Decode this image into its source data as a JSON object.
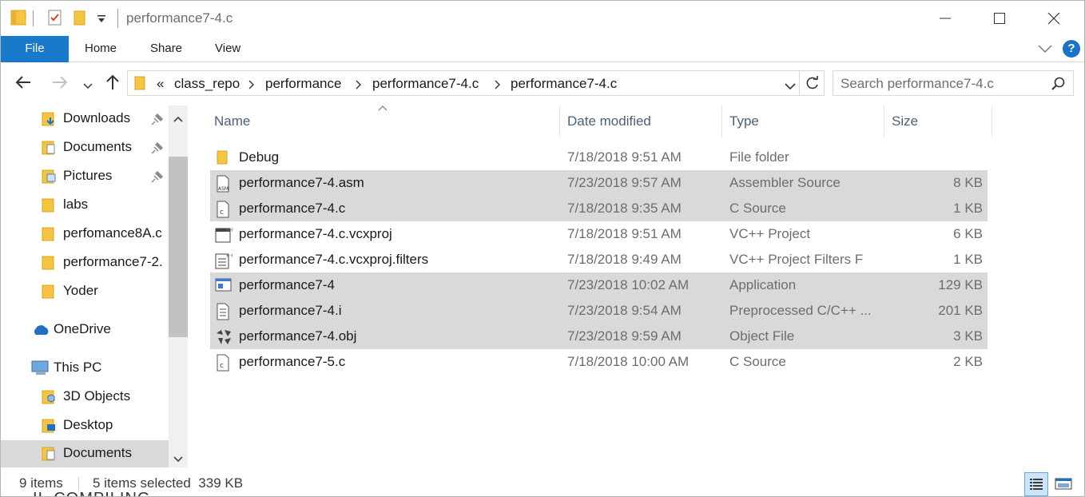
{
  "window": {
    "title": "performance7-4.c"
  },
  "ribbon": {
    "tabs": [
      "File",
      "Home",
      "Share",
      "View"
    ],
    "help_label": "?"
  },
  "address": {
    "overflow_glyph": "«",
    "crumbs": [
      "class_repo",
      "performance",
      "performance7-4.c",
      "performance7-4.c"
    ]
  },
  "search": {
    "placeholder": "Search performance7-4.c"
  },
  "navpane": {
    "items": [
      {
        "label": "Downloads",
        "icon": "downloads-folder-icon",
        "pinned": true,
        "selected": false
      },
      {
        "label": "Documents",
        "icon": "documents-folder-icon",
        "pinned": true,
        "selected": false
      },
      {
        "label": "Pictures",
        "icon": "pictures-folder-icon",
        "pinned": true,
        "selected": false
      },
      {
        "label": "labs",
        "icon": "folder-icon",
        "pinned": false,
        "selected": false
      },
      {
        "label": "perfomance8A.c",
        "icon": "folder-icon",
        "pinned": false,
        "selected": false
      },
      {
        "label": "performance7-2.",
        "icon": "folder-icon",
        "pinned": false,
        "selected": false
      },
      {
        "label": "Yoder",
        "icon": "folder-icon",
        "pinned": false,
        "selected": false
      },
      {
        "label": "OneDrive",
        "icon": "onedrive-cloud-icon",
        "pinned": false,
        "selected": false
      },
      {
        "label": "This PC",
        "icon": "this-pc-icon",
        "pinned": false,
        "selected": false
      },
      {
        "label": "3D Objects",
        "icon": "3d-objects-folder-icon",
        "pinned": false,
        "selected": false
      },
      {
        "label": "Desktop",
        "icon": "desktop-folder-icon",
        "pinned": false,
        "selected": false
      },
      {
        "label": "Documents",
        "icon": "documents-folder-icon",
        "pinned": false,
        "selected": true
      }
    ]
  },
  "columns": [
    "Name",
    "Date modified",
    "Type",
    "Size"
  ],
  "files": [
    {
      "name": "Debug",
      "date": "7/18/2018 9:51 AM",
      "type": "File folder",
      "size": "",
      "icon": "folder-icon",
      "selected": false
    },
    {
      "name": "performance7-4.asm",
      "date": "7/23/2018 9:57 AM",
      "type": "Assembler Source",
      "size": "8 KB",
      "icon": "asm-file-icon",
      "selected": true
    },
    {
      "name": "performance7-4.c",
      "date": "7/18/2018 9:35 AM",
      "type": "C Source",
      "size": "1 KB",
      "icon": "c-source-file-icon",
      "selected": true
    },
    {
      "name": "performance7-4.c.vcxproj",
      "date": "7/18/2018 9:51 AM",
      "type": "VC++ Project",
      "size": "6 KB",
      "icon": "vcxproj-file-icon",
      "selected": false
    },
    {
      "name": "performance7-4.c.vcxproj.filters",
      "date": "7/18/2018 9:49 AM",
      "type": "VC++ Project Filters F",
      "size": "1 KB",
      "icon": "vcxproj-filters-file-icon",
      "selected": false
    },
    {
      "name": "performance7-4",
      "date": "7/23/2018 10:02 AM",
      "type": "Application",
      "size": "129 KB",
      "icon": "application-icon",
      "selected": true
    },
    {
      "name": "performance7-4.i",
      "date": "7/23/2018 9:54 AM",
      "type": "Preprocessed C/C++ ...",
      "size": "201 KB",
      "icon": "text-file-icon",
      "selected": true
    },
    {
      "name": "performance7-4.obj",
      "date": "7/23/2018 9:59 AM",
      "type": "Object File",
      "size": "3 KB",
      "icon": "object-file-icon",
      "selected": true
    },
    {
      "name": "performance7-5.c",
      "date": "7/18/2018 10:00 AM",
      "type": "C Source",
      "size": "2 KB",
      "icon": "c-source-file-icon",
      "selected": false
    }
  ],
  "status": {
    "item_count": "9 items",
    "selection": "5 items selected  339 KB"
  },
  "background_text": "II. COMPILING",
  "colors": {
    "accent": "#1979ca",
    "selection": "#d9d9d9",
    "folder": "#f5c542",
    "header_text": "#4c607a"
  }
}
